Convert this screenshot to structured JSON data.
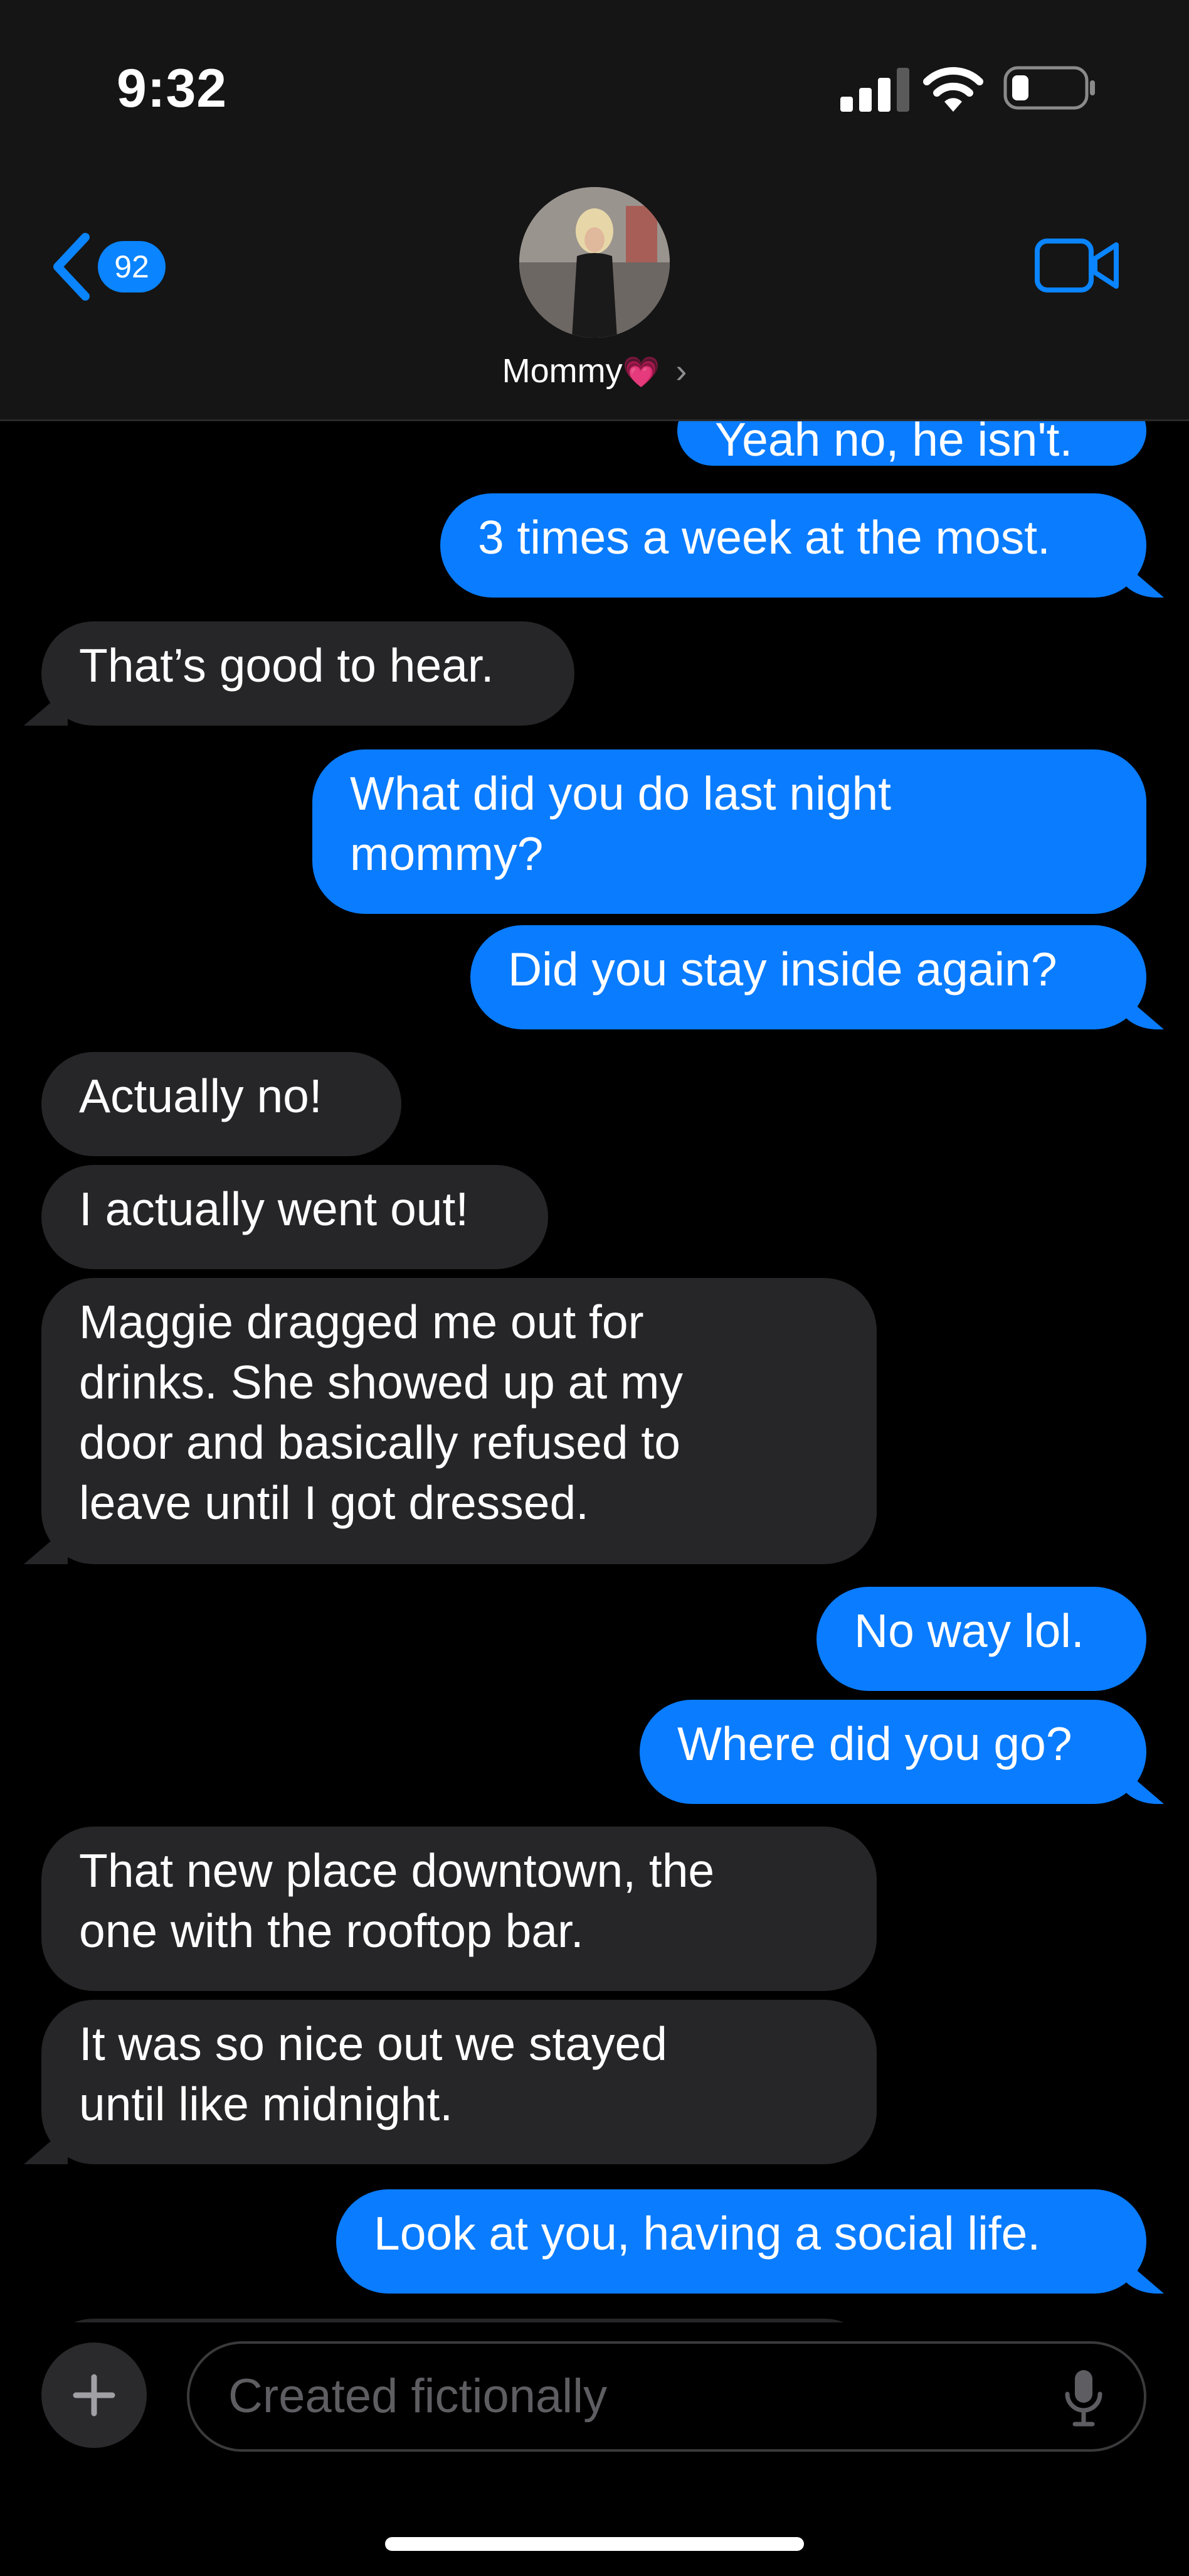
{
  "status_bar": {
    "time": "9:32"
  },
  "header": {
    "back_badge": "92",
    "contact_name": "Mommy",
    "contact_emoji": "💗",
    "chevron": "›",
    "icons": [
      "back-chevron-icon",
      "video-camera-icon"
    ]
  },
  "messages": [
    {
      "side": "sent",
      "text": "Yeah no, he isn't."
    },
    {
      "side": "sent",
      "text": "3 times a week at the most."
    },
    {
      "side": "recv",
      "text": "That’s good to hear."
    },
    {
      "side": "sent",
      "text": "What did you do last night\nmommy?"
    },
    {
      "side": "sent",
      "text": "Did you stay inside again?"
    },
    {
      "side": "recv",
      "text": "Actually no!"
    },
    {
      "side": "recv",
      "text": "I actually went out!"
    },
    {
      "side": "recv",
      "text": "Maggie dragged me out for\ndrinks. She showed up at my\ndoor and basically refused to\nleave until I got dressed."
    },
    {
      "side": "sent",
      "text": "No way lol."
    },
    {
      "side": "sent",
      "text": "Where did you go?"
    },
    {
      "side": "recv",
      "text": "That new place downtown, the\none with the rooftop bar."
    },
    {
      "side": "recv",
      "text": "It was so nice out we stayed\nuntil like midnight."
    },
    {
      "side": "sent",
      "text": "Look at you, having a social life."
    }
  ],
  "composer": {
    "placeholder": "Created fictionally",
    "icons": [
      "plus-icon",
      "microphone-icon"
    ]
  },
  "colors": {
    "sent_bubble": "#0a7cff",
    "recv_bubble": "#262628",
    "accent": "#0a84ff"
  }
}
